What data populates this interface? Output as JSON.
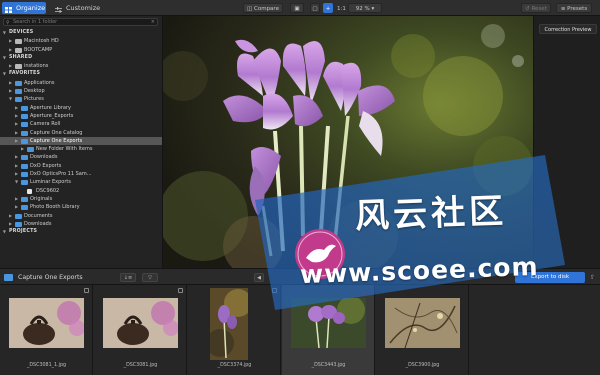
{
  "toolbar": {
    "tabs": [
      {
        "label": "Organize",
        "icon": "grid-icon",
        "active": true
      },
      {
        "label": "Customize",
        "icon": "sliders-icon",
        "active": false
      }
    ],
    "compare_label": "Compare",
    "zoom_label": "1:1",
    "zoom_value": "92 %",
    "reset_label": "Reset",
    "presets_label": "Presets"
  },
  "sidebar": {
    "search_placeholder": "Search in 1 folder",
    "tree": [
      {
        "type": "header",
        "label": "DEVICES",
        "depth": 0
      },
      {
        "type": "disk",
        "label": "Macintosh HD",
        "depth": 1
      },
      {
        "type": "disk",
        "label": "BOOTCAMP",
        "depth": 1
      },
      {
        "type": "header",
        "label": "SHARED",
        "depth": 0
      },
      {
        "type": "disk",
        "label": "instations",
        "depth": 1
      },
      {
        "type": "header",
        "label": "FAVORITES",
        "depth": 0
      },
      {
        "type": "folder",
        "label": "Applications",
        "depth": 1
      },
      {
        "type": "folder",
        "label": "Desktop",
        "depth": 1
      },
      {
        "type": "folder",
        "label": "Pictures",
        "depth": 1,
        "open": true
      },
      {
        "type": "folder",
        "label": "Aperture Library",
        "depth": 2
      },
      {
        "type": "folder",
        "label": "Aperture_Exports",
        "depth": 2
      },
      {
        "type": "folder",
        "label": "Camera Roll",
        "depth": 2
      },
      {
        "type": "folder",
        "label": "Capture One Catalog",
        "depth": 2
      },
      {
        "type": "folder",
        "label": "Capture One Exports",
        "depth": 2,
        "selected": true
      },
      {
        "type": "folder",
        "label": "New Folder With Items",
        "depth": 3
      },
      {
        "type": "folder",
        "label": "Downloads",
        "depth": 2
      },
      {
        "type": "folder",
        "label": "DxO Exports",
        "depth": 2
      },
      {
        "type": "folder",
        "label": "DxO OpticsPro 11 Sam...",
        "depth": 2
      },
      {
        "type": "folder",
        "label": "Luminar Exports",
        "depth": 2,
        "open": true
      },
      {
        "type": "doc",
        "label": "DSC9602",
        "depth": 3
      },
      {
        "type": "folder",
        "label": "Originals",
        "depth": 2
      },
      {
        "type": "folder",
        "label": "Photo Booth Library",
        "depth": 2
      },
      {
        "type": "folder",
        "label": "Documents",
        "depth": 1
      },
      {
        "type": "folder",
        "label": "Downloads",
        "depth": 1
      },
      {
        "type": "header",
        "label": "PROJECTS",
        "depth": 0
      }
    ]
  },
  "viewer": {
    "correction_preview_label": "Correction Preview"
  },
  "browser": {
    "folder_title": "Capture One Exports",
    "sort_label": "↓≡",
    "filter_label": "▽",
    "export_label": "Export to disk"
  },
  "filmstrip": {
    "items": [
      {
        "name": "_DSC3081_1.jpg",
        "subject": "kettle"
      },
      {
        "name": "_DSC3081.jpg",
        "subject": "kettle"
      },
      {
        "name": "_DSC3374.jpg",
        "subject": "flower-portrait"
      },
      {
        "name": "_DSC3443.jpg",
        "subject": "flower"
      },
      {
        "name": "_DSC3900.jpg",
        "subject": "branches"
      }
    ]
  },
  "watermark": {
    "line1": "风云社区",
    "line2": "www.scoee.com"
  },
  "colors": {
    "accent": "#2f74d6",
    "folder": "#4a97e0",
    "bg": "#1e1e1e",
    "sidebar": "#232323"
  }
}
